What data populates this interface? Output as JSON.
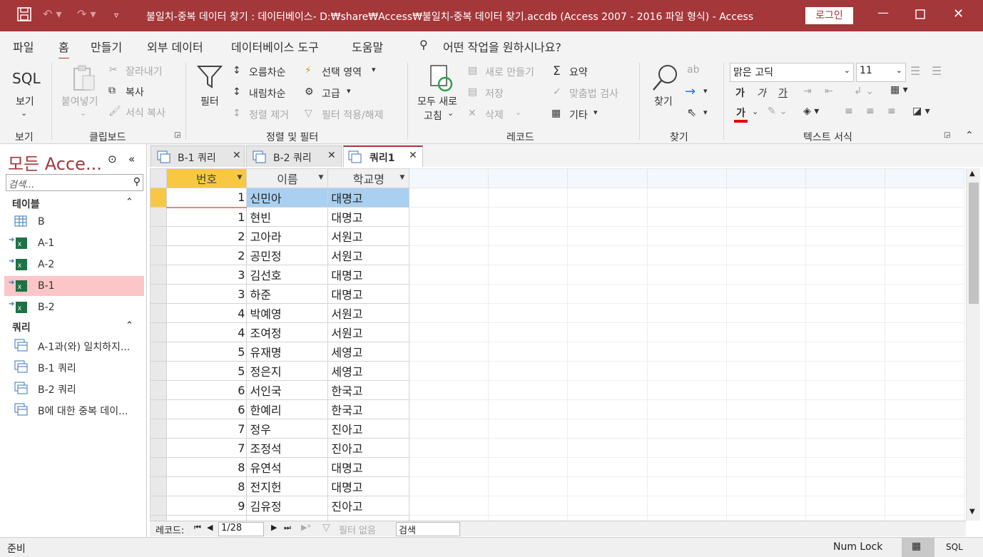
{
  "window": {
    "title": "불일치-중복 데이터 찾기 : 데이터베이스- D:₩share₩Access₩불일치-중복 데이터 찾기.accdb (Access 2007 - 2016 파일 형식)  -  Access",
    "login_label": "로그인"
  },
  "menu": {
    "items": [
      "파일",
      "홈",
      "만들기",
      "외부 데이터",
      "데이터베이스 도구",
      "도움말"
    ],
    "active": "홈",
    "tell_me": "어떤 작업을 원하시나요?"
  },
  "ribbon": {
    "views": {
      "sql": "SQL",
      "view": "보기",
      "group": "보기"
    },
    "clipboard": {
      "paste": "붙여넣기",
      "cut": "잘라내기",
      "copy": "복사",
      "format_painter": "서식 복사",
      "group": "클립보드"
    },
    "sort_filter": {
      "filter": "필터",
      "ascending": "오름차순",
      "descending": "내림차순",
      "remove_sort": "정렬 제거",
      "selection": "선택 영역",
      "advanced": "고급",
      "toggle_filter": "필터 적용/해제",
      "group": "정렬 및 필터"
    },
    "records": {
      "refresh_all_1": "모두 새로",
      "refresh_all_2": "고침",
      "new": "새로 만들기",
      "save": "저장",
      "delete": "삭제",
      "totals": "요약",
      "spelling": "맞춤법 검사",
      "more": "기타",
      "group": "레코드"
    },
    "find": {
      "find": "찾기",
      "group": "찾기"
    },
    "text_format": {
      "font": "맑은 고딕",
      "size": "11",
      "bold": "가",
      "italic": "가",
      "underline": "가",
      "font_color": "가",
      "group": "텍스트 서식"
    }
  },
  "nav": {
    "title": "모든 Acce...",
    "search_placeholder": "검색...",
    "tables_header": "테이블",
    "tables": [
      "B",
      "A-1",
      "A-2",
      "B-1",
      "B-2"
    ],
    "queries_header": "쿼리",
    "queries": [
      "A-1과(와) 일치하지...",
      "B-1 쿼리",
      "B-2 쿼리",
      "B에 대한 중복 데이..."
    ]
  },
  "tabs": [
    "B-1 쿼리",
    "B-2 쿼리",
    "쿼리1"
  ],
  "datasheet": {
    "columns": [
      "번호",
      "이름",
      "학교명"
    ],
    "rows": [
      [
        "1",
        "신민아",
        "대명고"
      ],
      [
        "1",
        "현빈",
        "대명고"
      ],
      [
        "2",
        "고아라",
        "서원고"
      ],
      [
        "2",
        "공민정",
        "서원고"
      ],
      [
        "3",
        "김선호",
        "대명고"
      ],
      [
        "3",
        "하준",
        "대명고"
      ],
      [
        "4",
        "박예영",
        "서원고"
      ],
      [
        "4",
        "조여정",
        "서원고"
      ],
      [
        "5",
        "유재명",
        "세영고"
      ],
      [
        "5",
        "정은지",
        "세영고"
      ],
      [
        "6",
        "서인국",
        "한국고"
      ],
      [
        "6",
        "한예리",
        "한국고"
      ],
      [
        "7",
        "정우",
        "진아고"
      ],
      [
        "7",
        "조정석",
        "진아고"
      ],
      [
        "8",
        "유연석",
        "대명고"
      ],
      [
        "8",
        "전지헌",
        "대명고"
      ],
      [
        "9",
        "김유정",
        "진아고"
      ]
    ]
  },
  "recnav": {
    "label": "레코드:",
    "position": "1/28",
    "filter": "필터 없음",
    "search": "검색"
  },
  "status": {
    "left": "준비",
    "numlock": "Num Lock",
    "sql": "SQL"
  },
  "colors": {
    "accent": "#a4373a",
    "selected_nav": "#fcc5c7",
    "selected_cell": "#a9d0f0"
  }
}
